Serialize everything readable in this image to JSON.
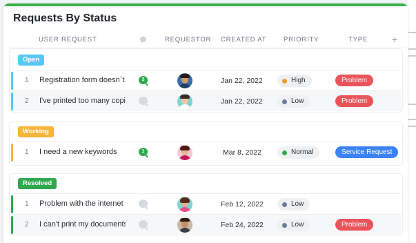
{
  "title": "Requests By Status",
  "columns": {
    "user_request": "USER REQUEST",
    "requestor": "REQUESTOR",
    "created_at": "CREATED AT",
    "priority": "PRIORITY",
    "type": "TYPE",
    "add": "+"
  },
  "colors": {
    "open": "#56c8f2",
    "working": "#f5b43c",
    "resolved": "#2fa84f",
    "priority_high": "#f59a23",
    "priority_low": "#6b7a99",
    "priority_normal": "#2fa84f",
    "type_problem": "#e9545b",
    "type_service": "#3b82f6"
  },
  "groups": [
    {
      "label": "Open",
      "rows": [
        {
          "num": "1",
          "request": "Registration form doesn`t...",
          "comments": "3",
          "date": "Jan 22, 2022",
          "priority": "High",
          "type": "Problem"
        },
        {
          "num": "2",
          "request": "I've printed too many copi...",
          "comments": "0",
          "date": "Jan 22, 2022",
          "priority": "Low",
          "type": "Problem"
        }
      ]
    },
    {
      "label": "Working",
      "rows": [
        {
          "num": "1",
          "request": "I need a new keywords",
          "comments": "1",
          "date": "Mar 8, 2022",
          "priority": "Normal",
          "type": "Service Request"
        }
      ]
    },
    {
      "label": "Resolved",
      "rows": [
        {
          "num": "1",
          "request": "Problem with the internet",
          "comments": "0",
          "date": "Feb 12, 2022",
          "priority": "Low",
          "type": ""
        },
        {
          "num": "2",
          "request": "I can't print my documents",
          "comments": "0",
          "date": "Feb 24, 2022",
          "priority": "Low",
          "type": "Problem"
        }
      ]
    }
  ]
}
